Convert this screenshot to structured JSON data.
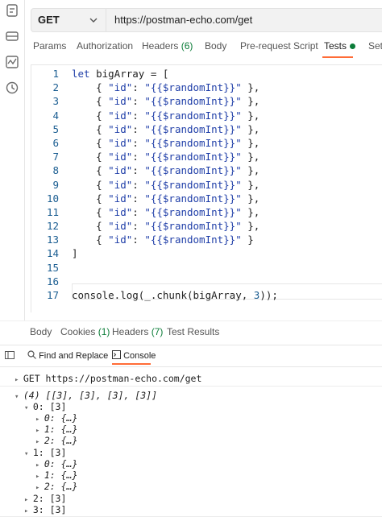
{
  "sidebar": {
    "icons": [
      "collections-icon",
      "environments-icon",
      "monitor-icon",
      "history-icon"
    ]
  },
  "request": {
    "method": "GET",
    "url": "https://postman-echo.com/get"
  },
  "tabs": {
    "params": "Params",
    "authorization": "Authorization",
    "headers": "Headers",
    "headers_count": "(6)",
    "body": "Body",
    "prerequest": "Pre-request Script",
    "tests": "Tests",
    "settings": "Set"
  },
  "editor": {
    "line_numbers": [
      "1",
      "2",
      "3",
      "4",
      "5",
      "6",
      "7",
      "8",
      "9",
      "10",
      "11",
      "12",
      "13",
      "14",
      "15",
      "16",
      "17"
    ],
    "line1_kw": "let",
    "line1_rest": " bigArray = [",
    "item_prefix": "    { ",
    "item_key": "\"id\"",
    "item_colon": ": ",
    "item_value": "\"{{$randomInt}}\"",
    "item_suffix_comma": " },",
    "item_suffix_last": " }",
    "line14": "]",
    "line17_a": "console.log(_.chunk(bigArray, ",
    "line17_num": "3",
    "line17_b": "));"
  },
  "response_tabs": {
    "body": "Body",
    "cookies": "Cookies",
    "cookies_count": "(1)",
    "headers": "Headers",
    "headers_count": "(7)",
    "test_results": "Test Results"
  },
  "bottom_bar": {
    "find_replace": "Find and Replace",
    "console": "Console"
  },
  "console": {
    "request_line": "GET https://postman-echo.com/get",
    "array_summary": "(4) [[3], [3], [3], [3]]",
    "entry0": "0: [3]",
    "entry0_0": "0: {…}",
    "entry0_1": "1: {…}",
    "entry0_2": "2: {…}",
    "entry1": "1: [3]",
    "entry1_0": "0: {…}",
    "entry1_1": "1: {…}",
    "entry1_2": "2: {…}",
    "entry2": "2: [3]",
    "entry3": "3: [3]"
  }
}
